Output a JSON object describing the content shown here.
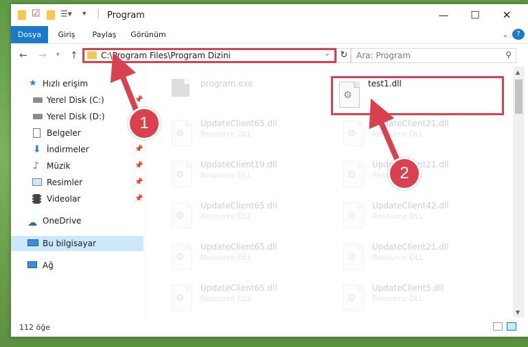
{
  "window": {
    "title": "Program",
    "controls": {
      "minimize": "—",
      "maximize": "☐",
      "close": "✕"
    }
  },
  "ribbon": {
    "tabs": [
      "Dosya",
      "Giriş",
      "Paylaş",
      "Görünüm"
    ],
    "help": "?"
  },
  "address": {
    "path": "C:\\Program Files\\Program Dizini",
    "search_placeholder": "Ara: Program"
  },
  "nav": {
    "items": [
      {
        "label": "Hızlı erişim",
        "icon": "star-icon",
        "pinned": false
      },
      {
        "label": "Yerel Disk (C:)",
        "icon": "drive-icon",
        "pinned": true
      },
      {
        "label": "Yerel Disk (D:)",
        "icon": "drive-icon",
        "pinned": true
      },
      {
        "label": "Belgeler",
        "icon": "document-icon",
        "pinned": true
      },
      {
        "label": "İndirmeler",
        "icon": "download-icon",
        "pinned": true
      },
      {
        "label": "Müzik",
        "icon": "music-icon",
        "pinned": true
      },
      {
        "label": "Resimler",
        "icon": "picture-icon",
        "pinned": true
      },
      {
        "label": "Videolar",
        "icon": "video-icon",
        "pinned": true
      },
      {
        "label": "OneDrive",
        "icon": "cloud-icon",
        "pinned": false
      },
      {
        "label": "Bu bilgisayar",
        "icon": "computer-icon",
        "pinned": false,
        "selected": true
      },
      {
        "label": "Ağ",
        "icon": "network-icon",
        "pinned": false
      }
    ]
  },
  "files": [
    {
      "name": "program.exe",
      "type": "",
      "faded": true
    },
    {
      "name": "test1.dll",
      "type": "",
      "faded": false,
      "highlighted": true
    },
    {
      "name": "UpdateClient65.dll",
      "type": "Resource DLL",
      "faded": true
    },
    {
      "name": "UpdateClient21.dll",
      "type": "Resource DLL",
      "faded": true
    },
    {
      "name": "UpdateClient19.dll",
      "type": "Resource DLL",
      "faded": true
    },
    {
      "name": "UpdateClient21.dll",
      "type": "Resource DLL",
      "faded": true
    },
    {
      "name": "UpdateClient65.dll",
      "type": "Resource DLL",
      "faded": true
    },
    {
      "name": "UpdateClient42.dll",
      "type": "Resource DLL",
      "faded": true
    },
    {
      "name": "UpdateClient65.dll",
      "type": "Resource DLL",
      "faded": true
    },
    {
      "name": "UpdateClient21.dll",
      "type": "Resource DLL",
      "faded": true
    },
    {
      "name": "UpdateClient65.dll",
      "type": "Resource DLL",
      "faded": true
    },
    {
      "name": "UpdateClient5.dll",
      "type": "Resource DLL",
      "faded": true
    }
  ],
  "status": {
    "item_count": "112 öğe"
  },
  "annotations": {
    "step1": "1",
    "step2": "2",
    "color": "#d9414e"
  }
}
